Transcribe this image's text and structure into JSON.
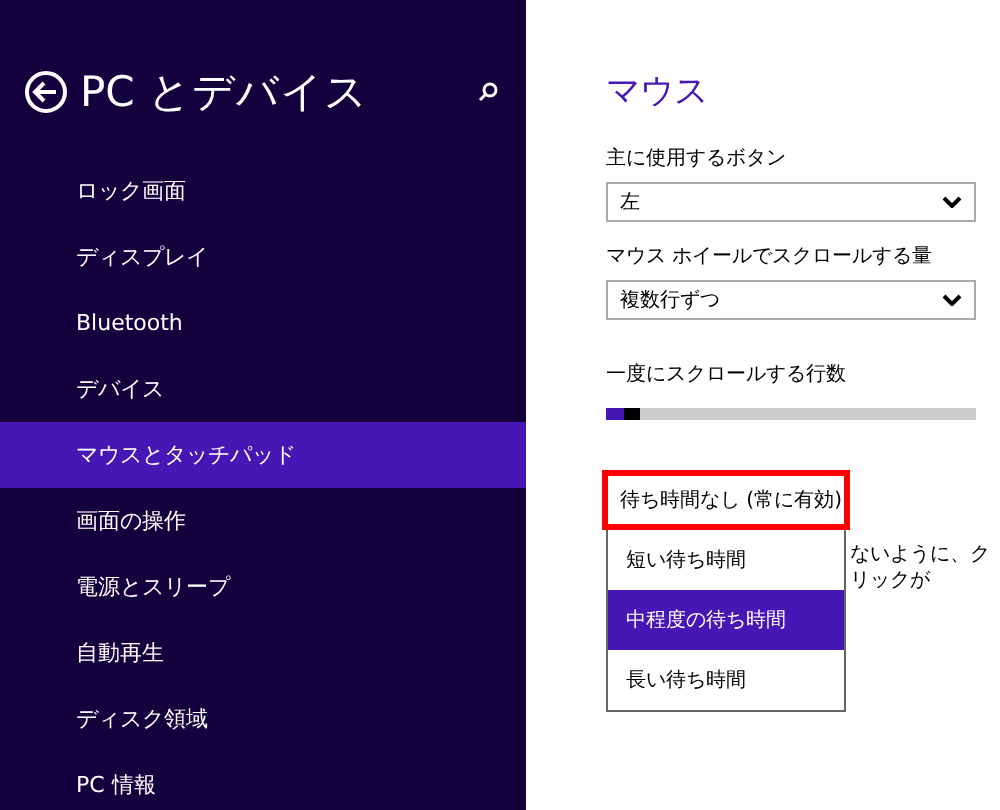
{
  "sidebar": {
    "title": "PC とデバイス",
    "items": [
      {
        "label": "ロック画面",
        "selected": false
      },
      {
        "label": "ディスプレイ",
        "selected": false
      },
      {
        "label": "Bluetooth",
        "selected": false
      },
      {
        "label": "デバイス",
        "selected": false
      },
      {
        "label": "マウスとタッチパッド",
        "selected": true
      },
      {
        "label": "画面の操作",
        "selected": false
      },
      {
        "label": "電源とスリープ",
        "selected": false
      },
      {
        "label": "自動再生",
        "selected": false
      },
      {
        "label": "ディスク領域",
        "selected": false
      },
      {
        "label": "PC 情報",
        "selected": false
      }
    ]
  },
  "content": {
    "title": "マウス",
    "settings": [
      {
        "kind": "select",
        "label": "主に使用するボタン",
        "value": "左"
      },
      {
        "kind": "select",
        "label": "マウス ホイールでスクロールする量",
        "value": "複数行ずつ"
      },
      {
        "kind": "slider",
        "label": "一度にスクロールする行数",
        "level": 0.05
      }
    ],
    "hidden_text": "ないように、クリックが",
    "dropdown": [
      {
        "label": "待ち時間なし (常に有効)",
        "selected": false,
        "outlined": true
      },
      {
        "label": "短い待ち時間",
        "selected": false,
        "outlined": false
      },
      {
        "label": "中程度の待ち時間",
        "selected": true,
        "outlined": false
      },
      {
        "label": "長い待ち時間",
        "selected": false,
        "outlined": false
      }
    ]
  }
}
